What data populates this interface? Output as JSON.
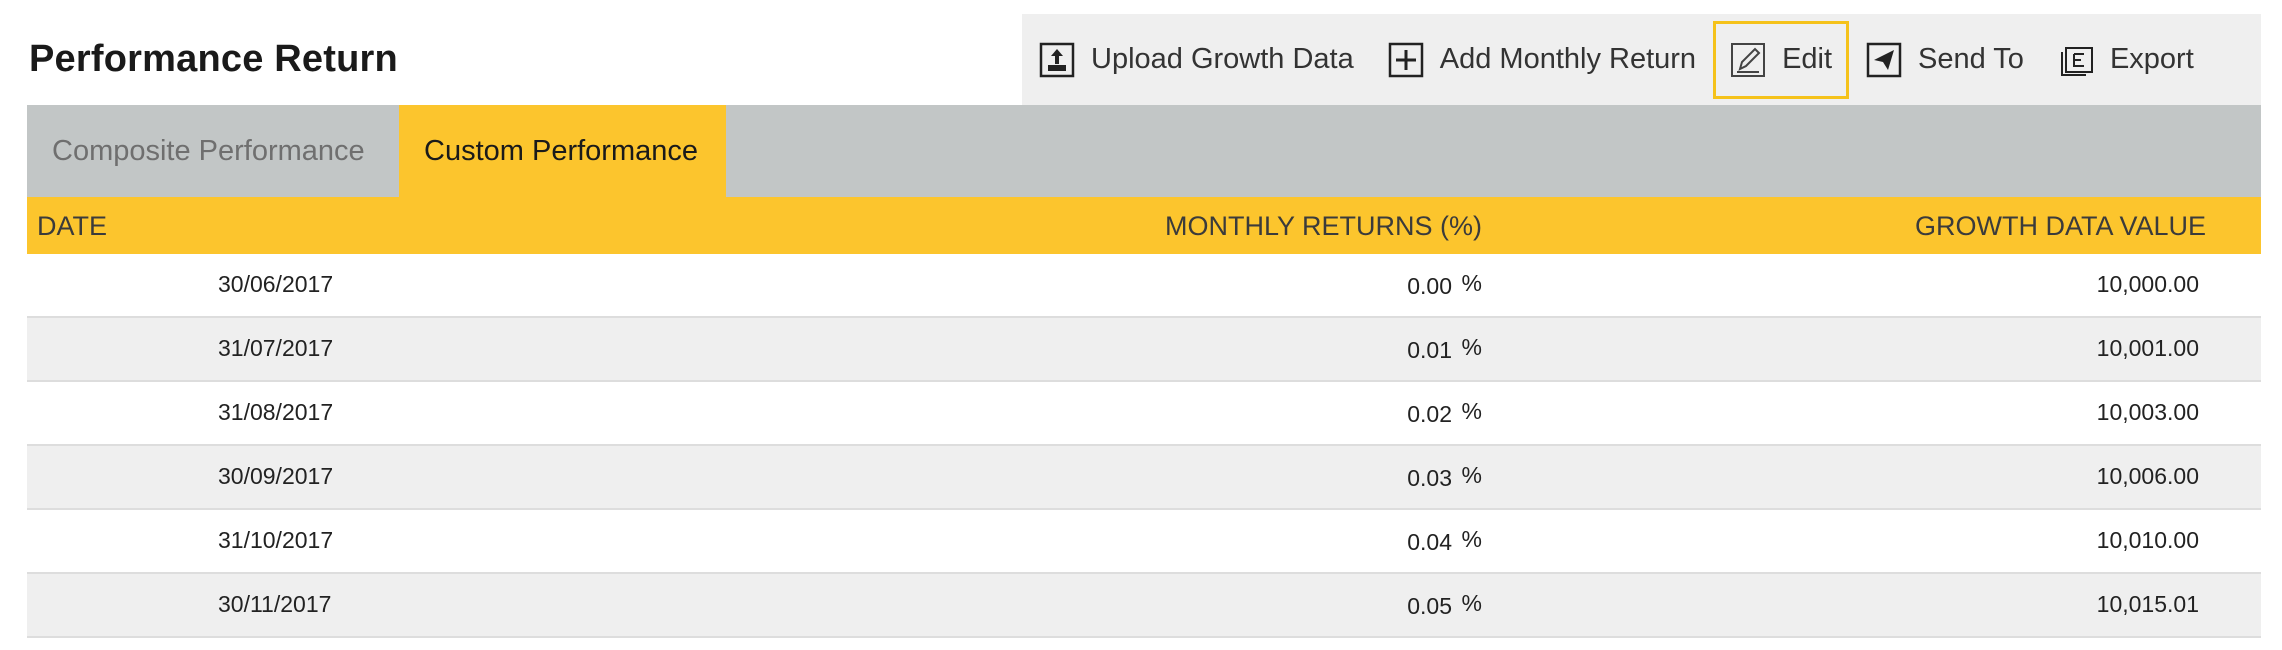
{
  "page": {
    "title": "Performance Return"
  },
  "toolbar": {
    "buttons": [
      {
        "label": "Upload Growth Data",
        "icon": "upload-icon"
      },
      {
        "label": "Add Monthly Return",
        "icon": "plus-box-icon"
      },
      {
        "label": "Edit",
        "icon": "edit-icon",
        "active": true
      },
      {
        "label": "Send To",
        "icon": "send-icon"
      },
      {
        "label": "Export",
        "icon": "export-icon"
      }
    ]
  },
  "tabs": [
    {
      "label": "Composite Performance",
      "active": false
    },
    {
      "label": "Custom Performance",
      "active": true
    }
  ],
  "table": {
    "headers": {
      "date": "DATE",
      "returns": "MONTHLY RETURNS (%)",
      "growth": "GROWTH DATA VALUE"
    },
    "rows": [
      {
        "date": "30/06/2017",
        "return": "0.00",
        "pct": "%",
        "growth": "10,000.00"
      },
      {
        "date": "31/07/2017",
        "return": "0.01",
        "pct": "%",
        "growth": "10,001.00"
      },
      {
        "date": "31/08/2017",
        "return": "0.02",
        "pct": "%",
        "growth": "10,003.00"
      },
      {
        "date": "30/09/2017",
        "return": "0.03",
        "pct": "%",
        "growth": "10,006.00"
      },
      {
        "date": "31/10/2017",
        "return": "0.04",
        "pct": "%",
        "growth": "10,010.00"
      },
      {
        "date": "30/11/2017",
        "return": "0.05",
        "pct": "%",
        "growth": "10,015.01"
      }
    ]
  },
  "colors": {
    "accent": "#fcc52d",
    "tab_bar": "#c2c6c6",
    "toolbar_bg": "#efefef",
    "row_alt": "#efefef",
    "active_border": "#f5c21b"
  }
}
